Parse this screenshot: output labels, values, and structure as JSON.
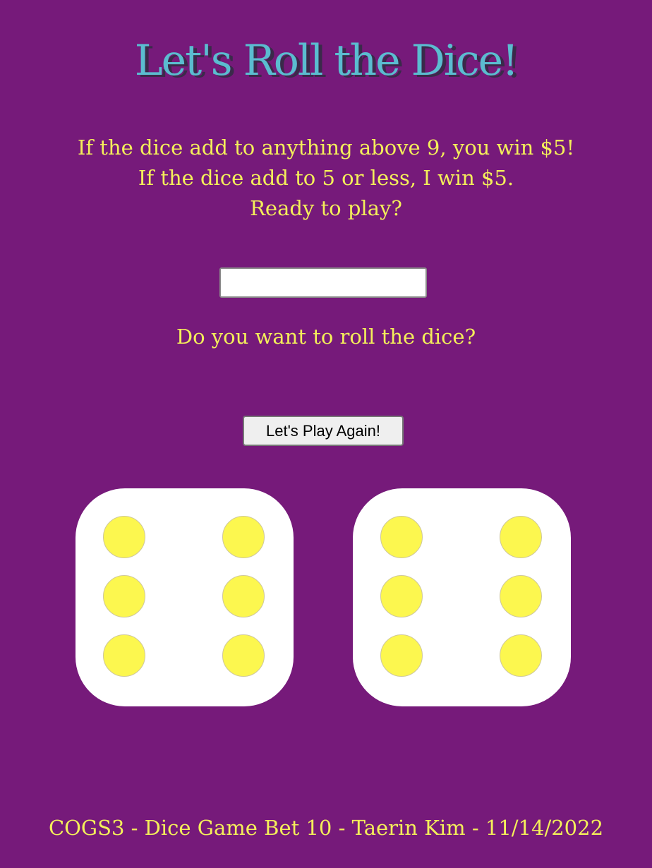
{
  "title": "Let's Roll the Dice!",
  "rules": [
    "If the dice add to anything above 9, you win $5!",
    "If the dice add to 5 or less, I win $5.",
    "Ready to play?"
  ],
  "bet_input": {
    "value": "",
    "placeholder": ""
  },
  "question": "Do you want to roll the dice?",
  "play_button_label": "Let's Play Again!",
  "dice": [
    {
      "value": 6
    },
    {
      "value": 6
    }
  ],
  "footer": "COGS3 - Dice Game Bet 10 - Taerin Kim - 11/14/2022",
  "colors": {
    "background": "#761a7a",
    "title": "#5bbcd0",
    "text": "#f4ef5a",
    "die_face": "#ffffff",
    "pip": "#fcf74f"
  }
}
